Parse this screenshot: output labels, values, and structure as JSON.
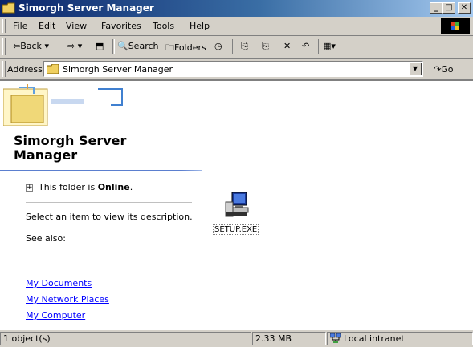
{
  "window": {
    "title": "Simorgh Server Manager"
  },
  "menu": [
    "File",
    "Edit",
    "View",
    "Favorites",
    "Tools",
    "Help"
  ],
  "toolbar": {
    "back": "Back",
    "search": "Search",
    "folders": "Folders"
  },
  "address": {
    "label": "Address",
    "value": "Simorgh Server Manager",
    "go": "Go"
  },
  "sidebar": {
    "heading_line1": "Simorgh Server",
    "heading_line2": "Manager",
    "status_prefix": "This folder is ",
    "status_value": "Online",
    "status_suffix": ".",
    "description": "Select an item to view its description.",
    "see_also": "See also:",
    "links": [
      "My Documents",
      "My Network Places",
      "My Computer"
    ]
  },
  "files": [
    {
      "name": "SETUP.EXE",
      "icon": "setup-exe-icon"
    }
  ],
  "statusbar": {
    "objects": "1 object(s)",
    "size": "2.33 MB",
    "zone": "Local intranet"
  }
}
